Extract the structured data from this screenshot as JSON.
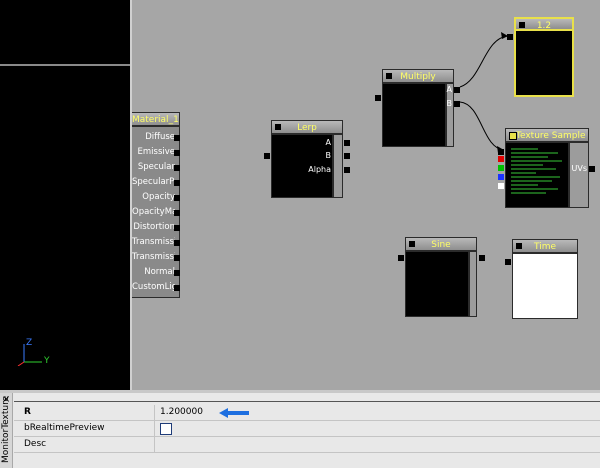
{
  "preview_viewport": {
    "axis_z": "Z",
    "axis_y": "Y"
  },
  "nodes": {
    "material": {
      "title": "Material_1",
      "inputs": [
        "Diffuse",
        "Emissive",
        "Specular",
        "SpecularPower",
        "Opacity",
        "OpacityMask",
        "Distortion",
        "TransmissionMask",
        "TransmissionColor",
        "Normal",
        "CustomLighting"
      ]
    },
    "lerp": {
      "title": "Lerp",
      "inputs": [
        "A",
        "B",
        "Alpha"
      ]
    },
    "multiply": {
      "title": "Multiply",
      "inputs": [
        "A",
        "B"
      ]
    },
    "constant": {
      "title": "1.2"
    },
    "texture_sample": {
      "title": "Texture Sample",
      "output": "UVs"
    },
    "sine": {
      "title": "Sine"
    },
    "time": {
      "title": "Time"
    }
  },
  "properties": {
    "panel_title": "MonitorTexture",
    "rows": [
      {
        "name": "R",
        "value": "1.200000"
      },
      {
        "name": "bRealtimePreview",
        "value": ""
      },
      {
        "name": "Desc",
        "value": ""
      }
    ]
  },
  "colors": {
    "node_title_text": "#ffff66",
    "selected_border": "#e8e04a",
    "graph_bg": "#a6a6a6",
    "arrow": "#1e6fe0"
  }
}
